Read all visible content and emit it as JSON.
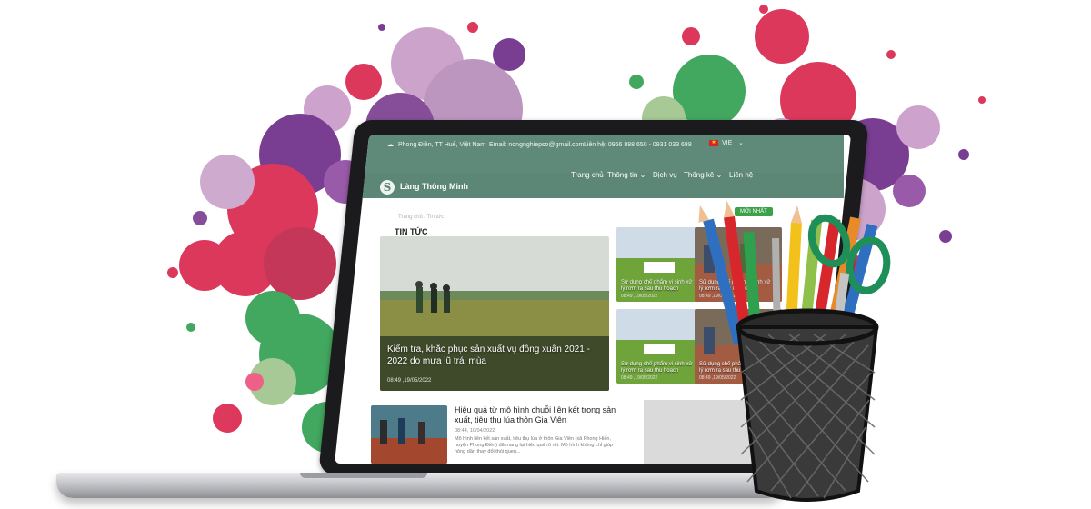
{
  "colors": {
    "brand": "#5f8a7a",
    "accent_green": "#3da04a"
  },
  "topbar": {
    "location": "Phong Điền, TT Huế, Việt Nam",
    "email": "Email: nongnghiepso@gmail.com",
    "contact": "Liên hệ: 0966 888 650 - 0931 033 688",
    "language": "VIE"
  },
  "logo": {
    "name": "Làng Thông Minh"
  },
  "nav": {
    "home": "Trang chủ",
    "info": "Thông tin",
    "services": "Dịch vụ",
    "stats": "Thống kê",
    "contact": "Liên hệ"
  },
  "breadcrumb": "Trang chủ  /  Tin tức",
  "page": {
    "title": "TIN TỨC",
    "badge": "MỚI NHẤT"
  },
  "hero": {
    "title": "Kiểm tra, khắc phục sản xuất vụ đông xuân 2021 - 2022 do mưa lũ trái mùa",
    "date": "08:49 ,19/05/2022"
  },
  "cards": [
    {
      "title": "Sử dụng chế phẩm vi sinh xử lý rơm rạ sau thu hoạch",
      "date": "08:49 ,19/05/2022"
    },
    {
      "title": "Sử dụng chế phẩm vi sinh xử lý rơm rạ sau thu hoạch",
      "date": "08:49 ,19/05/2022"
    },
    {
      "title": "Sử dụng chế phẩm vi sinh xử lý rơm rạ sau thu hoạch",
      "date": "08:49 ,19/05/2022"
    },
    {
      "title": "Sử dụng chế phẩm vi sinh xử lý rơm rạ sau thu hoạch",
      "date": "08:49 ,19/05/2022"
    }
  ],
  "article": {
    "title": "Hiệu quả từ mô hình chuỗi liên kết trong sản xuất, tiêu thụ lúa thôn Gia Viên",
    "date": "08:44, 10/04/2022",
    "excerpt": "Mô hình liên kết sản xuất, tiêu thụ lúa ở thôn Gia Viên (xã Phong Hiền, huyện Phong Điền) đã mang lại hiệu quả rõ rệt. Mô hình không chỉ giúp nông dân thay đổi thói quen..."
  }
}
